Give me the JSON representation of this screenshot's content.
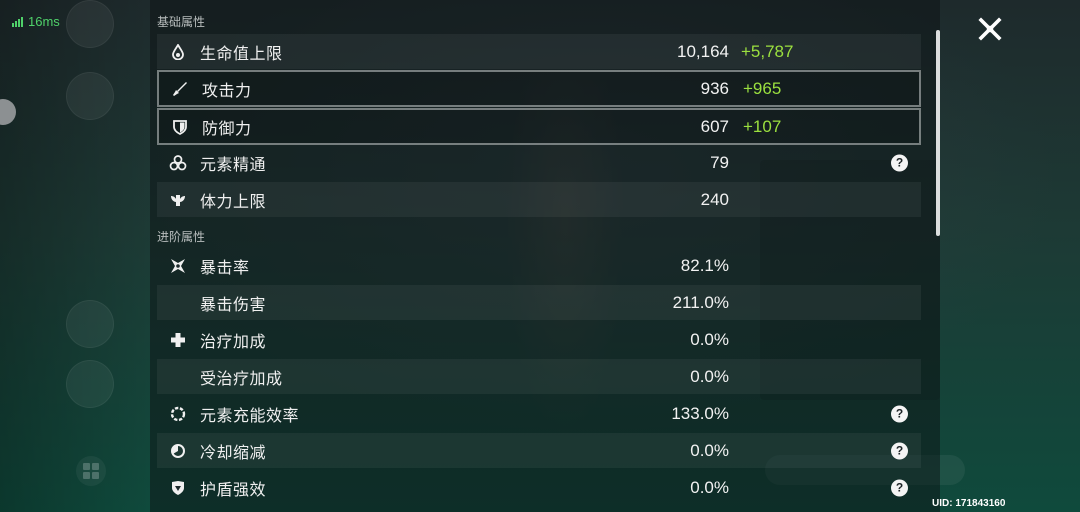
{
  "status": {
    "ping": "16ms"
  },
  "sections": {
    "base": "基础属性",
    "advanced": "进阶属性"
  },
  "stats": [
    {
      "key": "hp",
      "icon": "hp-drop-icon",
      "label": "生命值上限",
      "value": "10,164",
      "bonus": "+5,787",
      "help": false,
      "selected": false,
      "striped": true
    },
    {
      "key": "atk",
      "icon": "attack-sword-icon",
      "label": "攻击力",
      "value": "936",
      "bonus": "+965",
      "help": false,
      "selected": true,
      "striped": false
    },
    {
      "key": "def",
      "icon": "defense-shield-icon",
      "label": "防御力",
      "value": "607",
      "bonus": "+107",
      "help": false,
      "selected": true,
      "striped": true
    },
    {
      "key": "em",
      "icon": "elemental-mastery-icon",
      "label": "元素精通",
      "value": "79",
      "bonus": "",
      "help": true,
      "selected": false,
      "striped": false
    },
    {
      "key": "stamina",
      "icon": "stamina-icon",
      "label": "体力上限",
      "value": "240",
      "bonus": "",
      "help": false,
      "selected": false,
      "striped": true
    },
    {
      "key": "crit_rate",
      "icon": "crit-rate-icon",
      "label": "暴击率",
      "value": "82.1%",
      "bonus": "",
      "help": false,
      "selected": false,
      "striped": false
    },
    {
      "key": "crit_dmg",
      "icon": "",
      "label": "暴击伤害",
      "value": "211.0%",
      "bonus": "",
      "help": false,
      "selected": false,
      "striped": true
    },
    {
      "key": "healing",
      "icon": "healing-cross-icon",
      "label": "治疗加成",
      "value": "0.0%",
      "bonus": "",
      "help": false,
      "selected": false,
      "striped": false
    },
    {
      "key": "incoming_healing",
      "icon": "",
      "label": "受治疗加成",
      "value": "0.0%",
      "bonus": "",
      "help": false,
      "selected": false,
      "striped": true
    },
    {
      "key": "er",
      "icon": "energy-recharge-icon",
      "label": "元素充能效率",
      "value": "133.0%",
      "bonus": "",
      "help": true,
      "selected": false,
      "striped": false
    },
    {
      "key": "cd_reduction",
      "icon": "cooldown-icon",
      "label": "冷却缩减",
      "value": "0.0%",
      "bonus": "",
      "help": true,
      "selected": false,
      "striped": true
    },
    {
      "key": "shield",
      "icon": "shield-strength-icon",
      "label": "护盾强效",
      "value": "0.0%",
      "bonus": "",
      "help": true,
      "selected": false,
      "striped": false
    }
  ],
  "help_glyph": "?",
  "uid": "UID: 171843160",
  "colors": {
    "bonus": "#9be03f",
    "ping": "#4fd16a"
  }
}
